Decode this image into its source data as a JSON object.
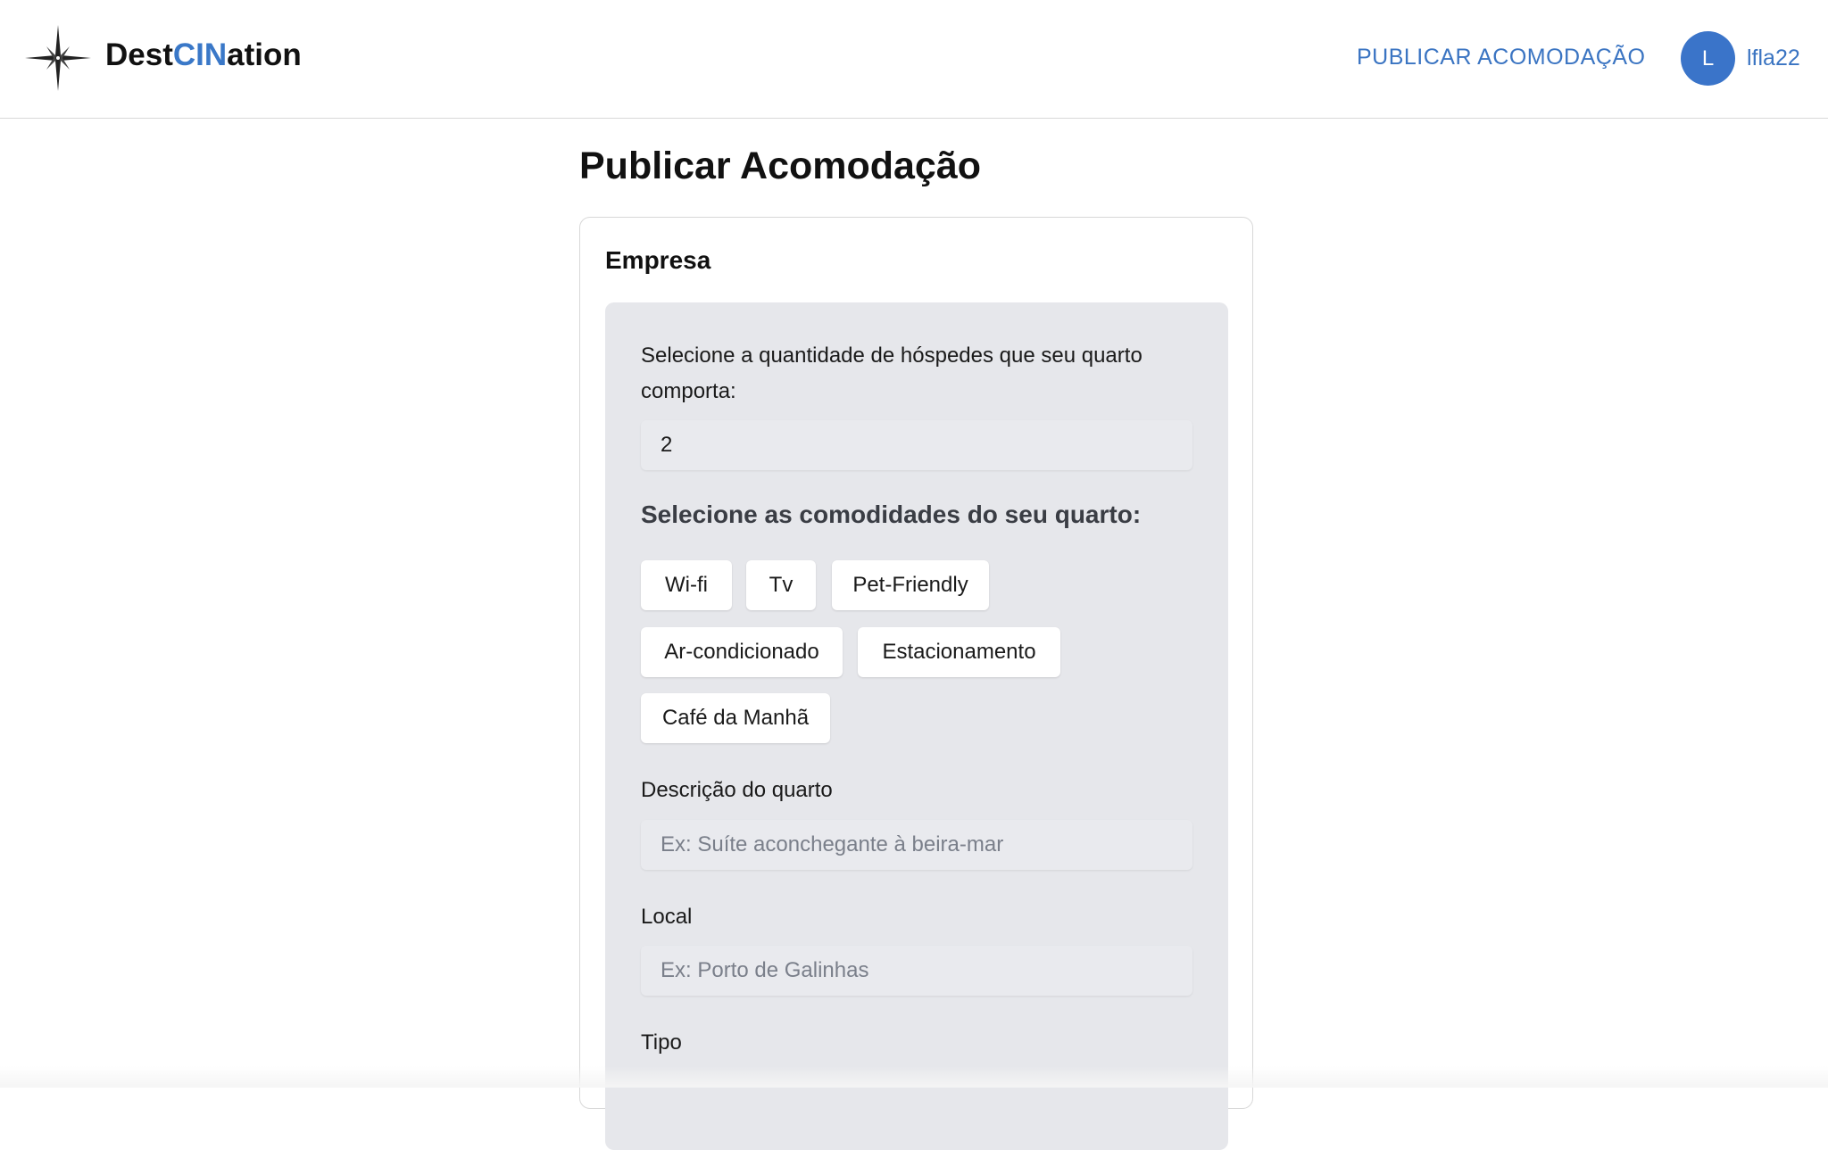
{
  "header": {
    "brand_prefix": "Dest",
    "brand_accent": "CIN",
    "brand_suffix": "ation",
    "publish_link": "PUBLICAR ACOMODAÇÃO",
    "avatar_initial": "L",
    "username": "lfla22",
    "logo_icon": "compass-star-icon"
  },
  "page": {
    "title": "Publicar Acomodação"
  },
  "card": {
    "title": "Empresa"
  },
  "form": {
    "guests_label": "Selecione a quantidade de hóspedes que seu quarto comporta:",
    "guests_value": "2",
    "amenities_title": "Selecione as comodidades do seu quarto:",
    "amenities": [
      "Wi-fi",
      "Tv",
      "Pet-Friendly",
      "Ar-condicionado",
      "Estacionamento",
      "Café da Manhã"
    ],
    "description_label": "Descrição do quarto",
    "description_placeholder": "Ex: Suíte aconchegante à beira-mar",
    "location_label": "Local",
    "location_placeholder": "Ex: Porto de Galinhas",
    "type_label": "Tipo"
  },
  "colors": {
    "accent": "#3a74c2",
    "avatar_bg": "#3a74c9",
    "panel_bg": "#e6e7eb"
  }
}
